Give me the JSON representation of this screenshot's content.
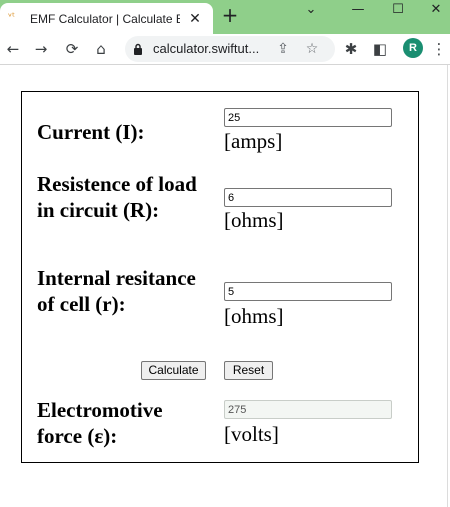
{
  "browser": {
    "tab": {
      "title": "EMF Calculator | Calculate Ele",
      "favicon_icon": "swiftutors-favicon-icon",
      "close_icon": "close-icon"
    },
    "new_tab_icon": "plus-icon",
    "window_controls": [
      "chevron-down-icon",
      "minimize-icon",
      "maximize-icon",
      "close-icon"
    ],
    "address": {
      "url": "calculator.swiftut..."
    },
    "profile_initial": "R",
    "profile_color": "#1a8e71",
    "tabstrip_color": "#8fcf8a"
  },
  "calculator": {
    "current": {
      "label": "Current (I):",
      "value": "25",
      "unit": "[amps]"
    },
    "load_resistance": {
      "label": "Resistence of load in circuit (R):",
      "value": "6",
      "unit": "[ohms]"
    },
    "internal_resistance": {
      "label": "Internal resitance of cell (r):",
      "value": "5",
      "unit": "[ohms]"
    },
    "calculate_label": "Calculate",
    "reset_label": "Reset",
    "emf": {
      "label": "Electromotive force (ε):",
      "value": "275",
      "unit": "[volts]"
    }
  }
}
